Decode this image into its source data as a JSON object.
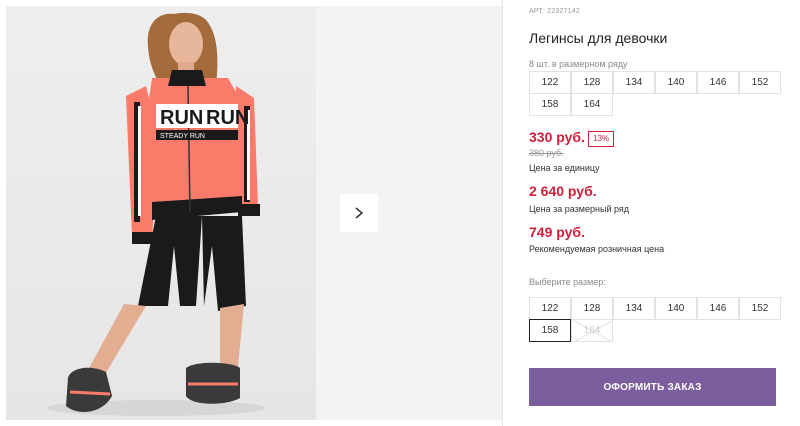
{
  "product": {
    "article": "АРТ: 22327142",
    "title": "Легинсы для девочки",
    "image_alt": "Girl in coral RUN jacket and black leggings"
  },
  "gallery": {
    "next_icon": "chevron-right-icon",
    "jacket_print_top": "RUN",
    "jacket_print_bottom": "STEADY RUN"
  },
  "size_range": {
    "label": "8 шт. в размерном ряду",
    "sizes": [
      "122",
      "128",
      "134",
      "140",
      "146",
      "152",
      "158",
      "164"
    ]
  },
  "pricing": {
    "unit_price": "330 руб.",
    "discount": "13%",
    "old_price": "380 руб.",
    "unit_caption": "Цена за единицу",
    "range_price": "2 640 руб.",
    "range_caption": "Цена за размерный ряд",
    "retail_price": "749 руб.",
    "retail_caption": "Рекомендуемая розничная цена"
  },
  "size_select": {
    "label": "Выберите размер:",
    "sizes": [
      "122",
      "128",
      "134",
      "140",
      "146",
      "152",
      "158",
      "164"
    ],
    "selected": "158",
    "disabled": "164"
  },
  "actions": {
    "order_label": "ОФОРМИТЬ ЗАКАЗ"
  },
  "colors": {
    "price_red": "#d31d3a",
    "order_button": "#7b5e9d",
    "jacket_coral": "#fb7b6a"
  }
}
